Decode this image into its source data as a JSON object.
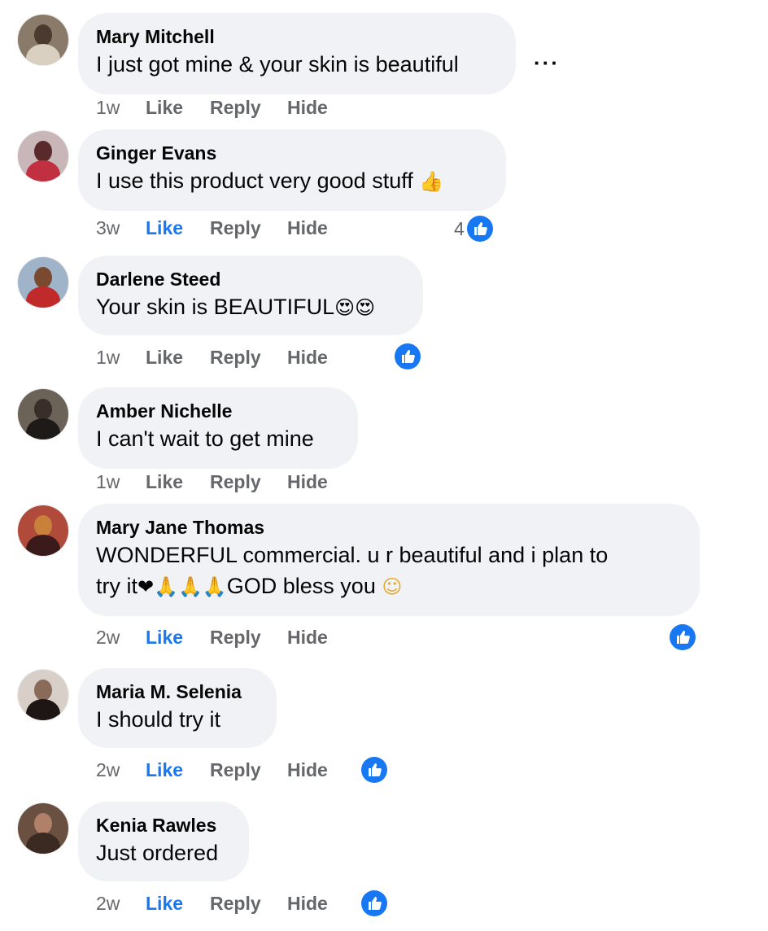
{
  "comments": [
    {
      "name": "Mary Mitchell",
      "text": "I just got mine & your skin is beautiful",
      "time": "1w",
      "like": "Like",
      "reply": "Reply",
      "hide": "Hide",
      "liked": false,
      "reaction_count": "",
      "avatar_colors": [
        "#8a7a6a",
        "#4a3a30",
        "#d9d0c2"
      ]
    },
    {
      "name": "Ginger Evans",
      "text": "I use this product very good stuff",
      "emoji": "👍",
      "time": "3w",
      "like": "Like",
      "reply": "Reply",
      "hide": "Hide",
      "liked": true,
      "reaction_count": "4",
      "avatar_colors": [
        "#c8b6b8",
        "#5a2a2a",
        "#c03040"
      ]
    },
    {
      "name": "Darlene Steed",
      "text": "Your skin is BEAUTIFUL",
      "emoji": "😍😍",
      "time": "1w",
      "like": "Like",
      "reply": "Reply",
      "hide": "Hide",
      "liked": false,
      "reaction_count": "",
      "avatar_colors": [
        "#9fb4c9",
        "#7a4a30",
        "#c02a2a"
      ]
    },
    {
      "name": "Amber Nichelle",
      "text": "I can't wait to get mine",
      "time": "1w",
      "like": "Like",
      "reply": "Reply",
      "hide": "Hide",
      "liked": false,
      "reaction_count": "",
      "avatar_colors": [
        "#6b6258",
        "#3a2e2a",
        "#1e1a18"
      ]
    },
    {
      "name": "Mary Jane Thomas",
      "text": "WONDERFUL commercial. u r beautiful and i plan to",
      "text2": "try it",
      "emoji2": "❤🙏🙏🙏",
      "text3": "GOD bless you",
      "emoji3": "☺",
      "time": "2w",
      "like": "Like",
      "reply": "Reply",
      "hide": "Hide",
      "liked": true,
      "reaction_count": "",
      "avatar_colors": [
        "#b04a3a",
        "#c8803a",
        "#3a1a1a"
      ]
    },
    {
      "name": "Maria M. Selenia",
      "text": "I should try it",
      "time": "2w",
      "like": "Like",
      "reply": "Reply",
      "hide": "Hide",
      "liked": true,
      "reaction_count": "",
      "avatar_colors": [
        "#d8d0c8",
        "#8a6a58",
        "#1e1614"
      ]
    },
    {
      "name": "Kenia Rawles",
      "text": "Just ordered",
      "time": "2w",
      "like": "Like",
      "reply": "Reply",
      "hide": "Hide",
      "liked": true,
      "reaction_count": "",
      "avatar_colors": [
        "#6a5040",
        "#b08068",
        "#3a2a22"
      ]
    }
  ],
  "more_menu_label": "···",
  "colors": {
    "accent": "#1877f2",
    "bubble": "#f0f2f5",
    "muted": "#65676b"
  }
}
